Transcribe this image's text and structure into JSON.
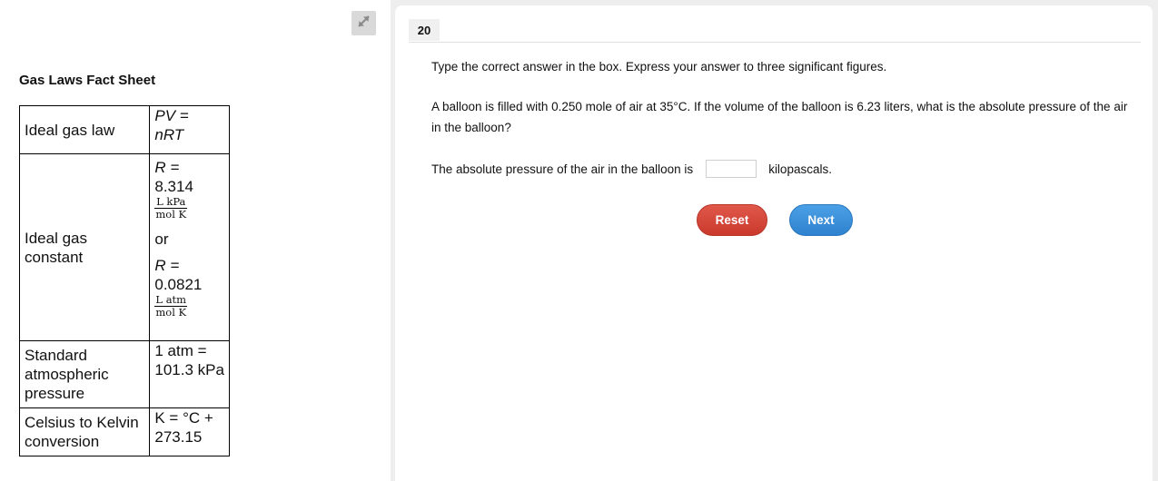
{
  "fact_sheet": {
    "title": "Gas Laws Fact Sheet",
    "rows": [
      {
        "name": "Ideal gas law",
        "value_pv": "PV =",
        "value_nrt": "nRT"
      },
      {
        "name": "Ideal gas constant",
        "r1_label": "R =",
        "r1_value": "8.314",
        "r1_unit_num": "L kPa",
        "r1_unit_den": "mol K",
        "or_text": "or",
        "r2_label": "R =",
        "r2_value": "0.0821",
        "r2_unit_num": "L atm",
        "r2_unit_den": "mol K"
      },
      {
        "name": "Standard atmospheric pressure",
        "value": "1 atm = 101.3 kPa"
      },
      {
        "name": "Celsius to Kelvin conversion",
        "value": "K = °C + 273.15"
      }
    ]
  },
  "question": {
    "number": "20",
    "instructions": "Type the correct answer in the box. Express your answer to three significant figures.",
    "text": "A balloon is filled with 0.250 mole of air at 35°C. If the volume of the balloon is 6.23 liters, what is the absolute pressure of the air in the balloon?",
    "answer_prefix": "The absolute pressure of the air in the balloon is",
    "answer_value": "",
    "answer_suffix": "kilopascals."
  },
  "buttons": {
    "reset_label": "Reset",
    "next_label": "Next"
  },
  "colors": {
    "reset": "#c9392c",
    "next": "#2f82cf"
  },
  "icons": {
    "expand": "expand-arrows-icon"
  }
}
